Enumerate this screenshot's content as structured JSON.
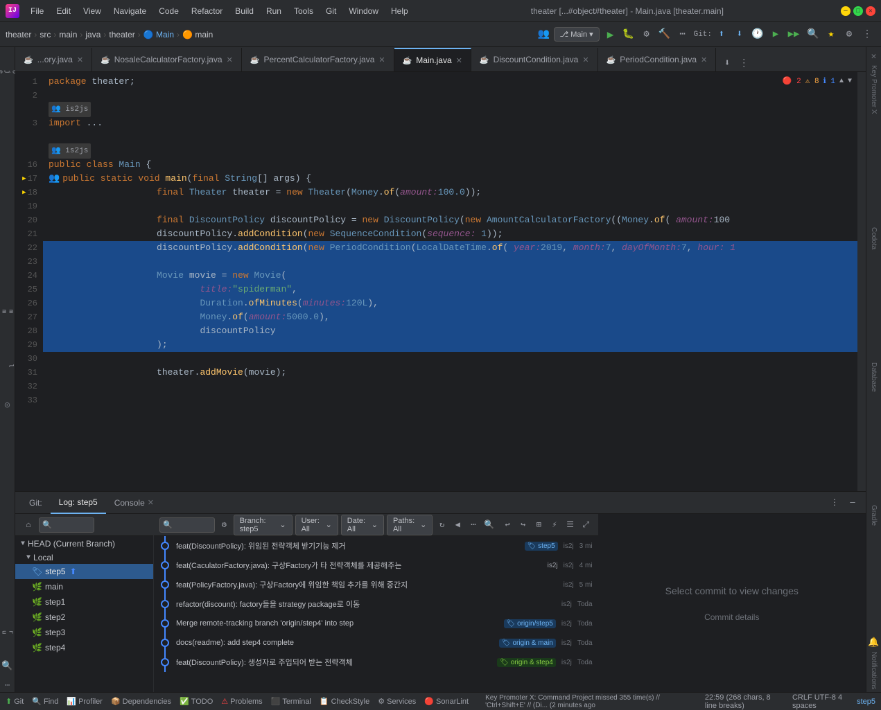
{
  "window": {
    "title": "theater [...#object#theater] - Main.java [theater.main]",
    "logo": "IJ"
  },
  "menu": {
    "items": [
      "File",
      "Edit",
      "View",
      "Navigate",
      "Code",
      "Refactor",
      "Build",
      "Run",
      "Tools",
      "Git",
      "Window",
      "Help"
    ]
  },
  "toolbar": {
    "breadcrumb": [
      "theater",
      "src",
      "main",
      "java",
      "theater",
      "Main",
      "main"
    ],
    "branch_btn": "Main",
    "run_config": "Main",
    "git_label": "Git:"
  },
  "tabs": [
    {
      "label": "...ory.java",
      "active": false,
      "closeable": true
    },
    {
      "label": "NosaleCalculatorFactory.java",
      "active": false,
      "closeable": true
    },
    {
      "label": "PercentCalculatorFactory.java",
      "active": false,
      "closeable": true
    },
    {
      "label": "Main.java",
      "active": true,
      "closeable": true
    },
    {
      "label": "DiscountCondition.java",
      "active": false,
      "closeable": true
    },
    {
      "label": "PeriodCondition.java",
      "active": false,
      "closeable": true
    }
  ],
  "editor": {
    "error_count": "2",
    "warning_count": "8",
    "info_count": "1",
    "lines": [
      {
        "num": 1,
        "content": "package theater;",
        "selected": false
      },
      {
        "num": 2,
        "content": "",
        "selected": false
      },
      {
        "num": 3,
        "content": "import ..."
      },
      {
        "num": 16,
        "content": ""
      },
      {
        "num": 17,
        "content": "public class Main {",
        "selected": false
      },
      {
        "num": 18,
        "content": "    public static void main(final String[] args) {",
        "selected": false
      },
      {
        "num": 19,
        "content": "        final Theater theater = new Theater(Money.of( amount: 100.0));",
        "selected": false
      },
      {
        "num": 20,
        "content": ""
      },
      {
        "num": 21,
        "content": "        final DiscountPolicy discountPolicy = new DiscountPolicy(new AmountCalculatorFactory((Money.of( amount: 100",
        "selected": false
      },
      {
        "num": 22,
        "content": "        discountPolicy.addCondition(new SequenceCondition( sequence: 1));",
        "selected": false
      },
      {
        "num": 23,
        "content": "        discountPolicy.addCondition(new PeriodCondition(LocalDateTime.of( year: 2019,  month: 7,  dayOfMonth: 7, hour: 1",
        "selected": true
      },
      {
        "num": 24,
        "content": ""
      },
      {
        "num": 25,
        "content": "        Movie movie = new Movie(",
        "selected": true
      },
      {
        "num": 26,
        "content": "                title: \"spiderman\",",
        "selected": true
      },
      {
        "num": 27,
        "content": "                Duration.ofMinutes( minutes: 120L),",
        "selected": true
      },
      {
        "num": 28,
        "content": "                Money.of( amount: 5000.0),",
        "selected": true
      },
      {
        "num": 29,
        "content": "                discountPolicy",
        "selected": true
      },
      {
        "num": 30,
        "content": "        );",
        "selected": true
      },
      {
        "num": 31,
        "content": ""
      },
      {
        "num": 32,
        "content": "        theater.addMovie(movie);"
      },
      {
        "num": 33,
        "content": ""
      }
    ]
  },
  "bottom_panel": {
    "tabs": [
      {
        "label": "Git:",
        "active": false
      },
      {
        "label": "Log: step5",
        "active": true
      },
      {
        "label": "Console",
        "active": false
      }
    ]
  },
  "git_log": {
    "head_label": "HEAD (Current Branch)",
    "local_label": "Local",
    "branches": [
      {
        "name": "step5",
        "active": true,
        "has_arrow": true
      },
      {
        "name": "main"
      },
      {
        "name": "step1"
      },
      {
        "name": "step2"
      },
      {
        "name": "step3"
      },
      {
        "name": "step4"
      }
    ],
    "filter": {
      "branch": "Branch: step5",
      "user": "User: All",
      "date": "Date: All",
      "paths": "Paths: All"
    },
    "commits": [
      {
        "msg": "feat(DiscountPolicy): 위임된 전략객체 받기기능 제거",
        "tags": [
          "step5"
        ],
        "author": "is2j",
        "time": "3 mi"
      },
      {
        "msg": "feat(CaculatorFactory.java): 구상Factory가 타 전략객체를 제공해주는",
        "tags": [
          "is2j"
        ],
        "author": "is2j",
        "time": "4 mi"
      },
      {
        "msg": "feat(PolicyFactory.java): 구상Factory에 위임한 책임 추가를 위해 중간지",
        "tags": [
          "is2j"
        ],
        "author": "is2j",
        "time": "5 mi"
      },
      {
        "msg": "refactor(discount): factory들을 strategy package로 이동",
        "tags": [],
        "author": "is2j",
        "time": "Toda"
      },
      {
        "msg": "Merge remote-tracking branch 'origin/step4' into step",
        "tags": [
          "origin/step5"
        ],
        "author": "is2j",
        "time": "Toda"
      },
      {
        "msg": "docs(readme): add step4 complete",
        "tags": [
          "origin & main"
        ],
        "author": "is2j",
        "time": "Toda"
      },
      {
        "msg": "feat(DiscountPolicy): 생성자로 주입되어 받는 전략객체",
        "tags": [
          "origin & step4"
        ],
        "author": "is2j",
        "time": "Toda"
      }
    ],
    "select_commit_text": "Select commit to view changes",
    "commit_details_label": "Commit details"
  },
  "status_bar": {
    "git_branch": "Git",
    "find_label": "Find",
    "profiler_label": "Profiler",
    "dependencies_label": "Dependencies",
    "todo_label": "TODO",
    "problems_label": "Problems",
    "terminal_label": "Terminal",
    "checkstyle_label": "CheckStyle",
    "services_label": "Services",
    "sonar_label": "SonarLint",
    "key_promoter_msg": "Key Promoter X: Command Project missed 355 time(s) // 'Ctrl+Shift+E' // (Di... (2 minutes ago",
    "cursor_pos": "22:59 (268 chars, 8 line breaks)",
    "encoding": "CRLF  UTF-8  4 spaces",
    "indent": "step5"
  }
}
